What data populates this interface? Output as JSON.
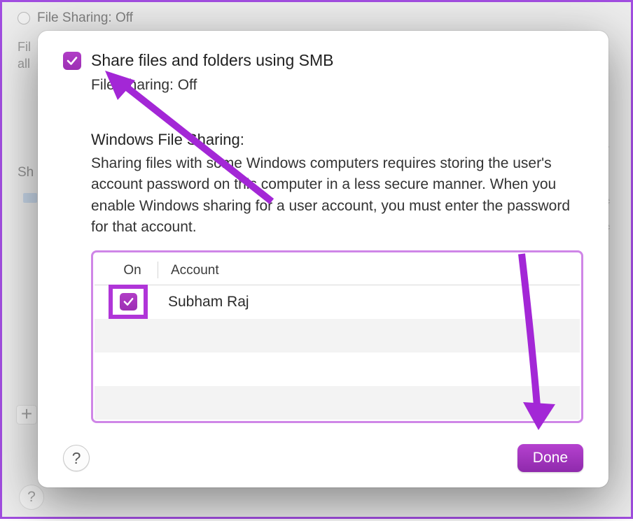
{
  "background": {
    "file_sharing_label": "File Sharing: Off",
    "sub_text_line1": "Fil",
    "sub_text_line2": "all",
    "sh_label": "Sh",
    "plus_label": "+"
  },
  "sheet": {
    "smb_checkbox_label": "Share files and folders using SMB",
    "file_sharing_status": "File Sharing: Off",
    "windows_heading": "Windows File Sharing:",
    "windows_desc": "Sharing files with some Windows computers requires storing the user's account password on this computer in a less secure manner. When you enable Windows sharing for a user account, you must enter the password for that account.",
    "columns": {
      "on": "On",
      "account": "Account"
    },
    "rows": [
      {
        "on": true,
        "account": "Subham Raj"
      }
    ],
    "help_label": "?",
    "done_label": "Done"
  }
}
